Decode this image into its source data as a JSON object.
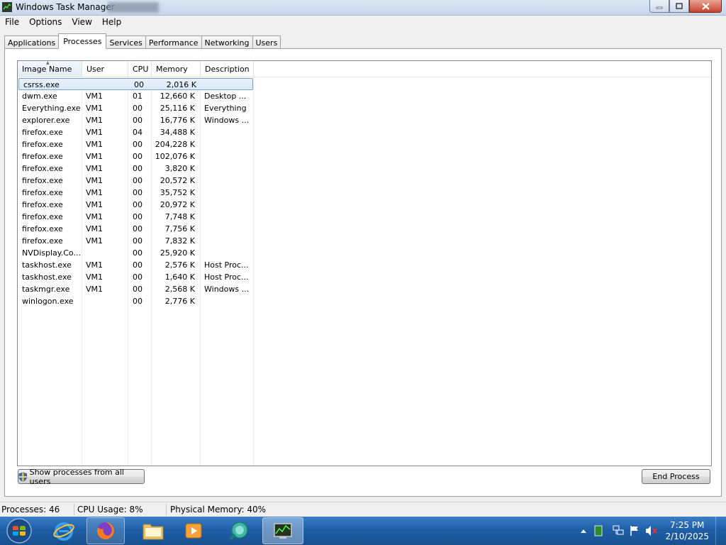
{
  "window": {
    "title": "Windows Task Manager"
  },
  "menu": [
    "File",
    "Options",
    "View",
    "Help"
  ],
  "tabs": [
    {
      "label": "Applications",
      "active": false
    },
    {
      "label": "Processes",
      "active": true
    },
    {
      "label": "Services",
      "active": false
    },
    {
      "label": "Performance",
      "active": false
    },
    {
      "label": "Networking",
      "active": false
    },
    {
      "label": "Users",
      "active": false
    }
  ],
  "columns": [
    "Image Name",
    "User Name",
    "CPU",
    "Memory (...",
    "Description"
  ],
  "processes": [
    {
      "name": "csrss.exe",
      "user": "",
      "cpu": "00",
      "mem": "2,016 K",
      "desc": "",
      "selected": true
    },
    {
      "name": "dwm.exe",
      "user": "VM1",
      "cpu": "01",
      "mem": "12,660 K",
      "desc": "Desktop ..."
    },
    {
      "name": "Everything.exe",
      "user": "VM1",
      "cpu": "00",
      "mem": "25,116 K",
      "desc": "Everything"
    },
    {
      "name": "explorer.exe",
      "user": "VM1",
      "cpu": "00",
      "mem": "16,776 K",
      "desc": "Windows ..."
    },
    {
      "name": "firefox.exe",
      "user": "VM1",
      "cpu": "04",
      "mem": "34,488 K",
      "desc": ""
    },
    {
      "name": "firefox.exe",
      "user": "VM1",
      "cpu": "00",
      "mem": "204,228 K",
      "desc": ""
    },
    {
      "name": "firefox.exe",
      "user": "VM1",
      "cpu": "00",
      "mem": "102,076 K",
      "desc": ""
    },
    {
      "name": "firefox.exe",
      "user": "VM1",
      "cpu": "00",
      "mem": "3,820 K",
      "desc": ""
    },
    {
      "name": "firefox.exe",
      "user": "VM1",
      "cpu": "00",
      "mem": "20,572 K",
      "desc": ""
    },
    {
      "name": "firefox.exe",
      "user": "VM1",
      "cpu": "00",
      "mem": "35,752 K",
      "desc": ""
    },
    {
      "name": "firefox.exe",
      "user": "VM1",
      "cpu": "00",
      "mem": "20,972 K",
      "desc": ""
    },
    {
      "name": "firefox.exe",
      "user": "VM1",
      "cpu": "00",
      "mem": "7,748 K",
      "desc": ""
    },
    {
      "name": "firefox.exe",
      "user": "VM1",
      "cpu": "00",
      "mem": "7,756 K",
      "desc": ""
    },
    {
      "name": "firefox.exe",
      "user": "VM1",
      "cpu": "00",
      "mem": "7,832 K",
      "desc": ""
    },
    {
      "name": "NVDisplay.Co...",
      "user": "",
      "cpu": "00",
      "mem": "25,920 K",
      "desc": ""
    },
    {
      "name": "taskhost.exe",
      "user": "VM1",
      "cpu": "00",
      "mem": "2,576 K",
      "desc": "Host Proc..."
    },
    {
      "name": "taskhost.exe",
      "user": "VM1",
      "cpu": "00",
      "mem": "1,640 K",
      "desc": "Host Proc..."
    },
    {
      "name": "taskmgr.exe",
      "user": "VM1",
      "cpu": "00",
      "mem": "2,568 K",
      "desc": "Windows ..."
    },
    {
      "name": "winlogon.exe",
      "user": "",
      "cpu": "00",
      "mem": "2,776 K",
      "desc": ""
    }
  ],
  "buttons": {
    "show_all": "Show processes from all users",
    "end_process": "End Process"
  },
  "status": {
    "processes": "Processes: 46",
    "cpu": "CPU Usage: 8%",
    "memory": "Physical Memory: 40%"
  },
  "taskbar": {
    "items": [
      "start-orb",
      "internet-explorer",
      "firefox",
      "windows-explorer",
      "media-player",
      "everything",
      "task-manager"
    ],
    "clock_time": "7:25 PM",
    "clock_date": "2/10/2025"
  },
  "colors": {
    "taskbar": "#1f5fa8",
    "selection": "#d9e9f9",
    "title_bar": "#c7d6ea"
  }
}
